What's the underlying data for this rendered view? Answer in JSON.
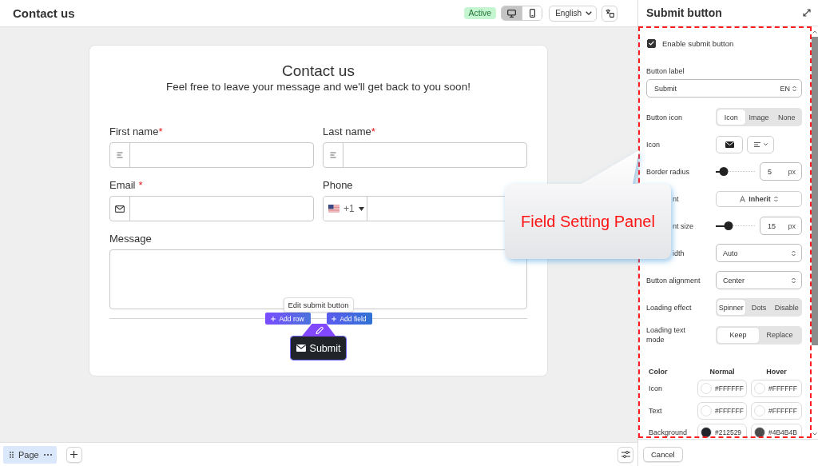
{
  "topbar": {
    "title": "Contact us",
    "status": "Active",
    "devices": [
      {
        "kind": "desktop",
        "selected": true
      },
      {
        "kind": "mobile",
        "selected": false
      }
    ],
    "language": "English"
  },
  "form": {
    "title": "Contact us",
    "subtitle": "Feel free to leave your message and we'll get back to you soon!",
    "fields": [
      {
        "kind": "text",
        "label": "First name",
        "required_mark": "*",
        "mark_gap": false
      },
      {
        "kind": "text",
        "label": "Last name",
        "required_mark": "*",
        "mark_gap": false
      },
      {
        "kind": "email",
        "label": "Email",
        "required_mark": "*",
        "mark_gap": true
      },
      {
        "kind": "phone",
        "label": "Phone",
        "dial_code": "+1"
      },
      {
        "kind": "textarea",
        "label": "Message"
      }
    ],
    "editor": {
      "tooltip": "Edit submit button",
      "add_row": "Add row",
      "add_field": "Add field"
    },
    "submit": {
      "label": "Submit",
      "selected": true
    }
  },
  "bottombar": {
    "pages": [
      {
        "label": "Page",
        "selected": true
      }
    ]
  },
  "panel": {
    "title": "Submit button",
    "enable": {
      "label": "Enable submit button",
      "checked": true
    },
    "label_field": {
      "label": "Button label",
      "value": "Submit",
      "language": "EN"
    },
    "rows": [
      {
        "kind": "segmented",
        "label": "Button icon",
        "options": [
          {
            "label": "Icon",
            "selected": true
          },
          {
            "label": "Image",
            "selected": false
          },
          {
            "label": "None",
            "selected": false
          }
        ]
      },
      {
        "kind": "icon-picker",
        "label": "Icon"
      },
      {
        "kind": "slider",
        "label": "Border radius",
        "level": 0.2,
        "value": "5",
        "unit": "px"
      },
      {
        "kind": "font-select",
        "label_tail": "nt",
        "value": "Inherit"
      },
      {
        "kind": "slider",
        "label_tail": "nt size",
        "level": 0.33,
        "value": "15",
        "unit": "px"
      },
      {
        "kind": "select",
        "label_tail": "idth",
        "value": "Auto"
      },
      {
        "kind": "select",
        "label": "Button alignment",
        "value": "Center"
      },
      {
        "kind": "segmented",
        "label": "Loading effect",
        "options": [
          {
            "label": "Spinner",
            "selected": true
          },
          {
            "label": "Dots",
            "selected": false
          },
          {
            "label": "Disable",
            "selected": false
          }
        ]
      },
      {
        "kind": "segmented",
        "label": "Loading text mode",
        "options": [
          {
            "label": "Keep",
            "selected": true
          },
          {
            "label": "Replace",
            "selected": false
          }
        ]
      }
    ],
    "colors": {
      "columns": [
        "Color",
        "Normal",
        "Hover"
      ],
      "rows": [
        {
          "label": "Icon",
          "normal": {
            "value": "#FFFFFF",
            "color": "#ffffff"
          },
          "hover": {
            "value": "#FFFFFF",
            "color": "#ffffff"
          }
        },
        {
          "label": "Text",
          "normal": {
            "value": "#FFFFFF",
            "color": "#ffffff"
          },
          "hover": {
            "value": "#FFFFFF",
            "color": "#ffffff"
          }
        },
        {
          "label": "Background",
          "normal": {
            "value": "#212529",
            "color": "#212529"
          },
          "hover": {
            "value": "#4B4B4B",
            "color": "#4b4b4b"
          }
        }
      ]
    },
    "cancel": "Cancel"
  },
  "annotation": {
    "text": "Field Setting Panel"
  }
}
